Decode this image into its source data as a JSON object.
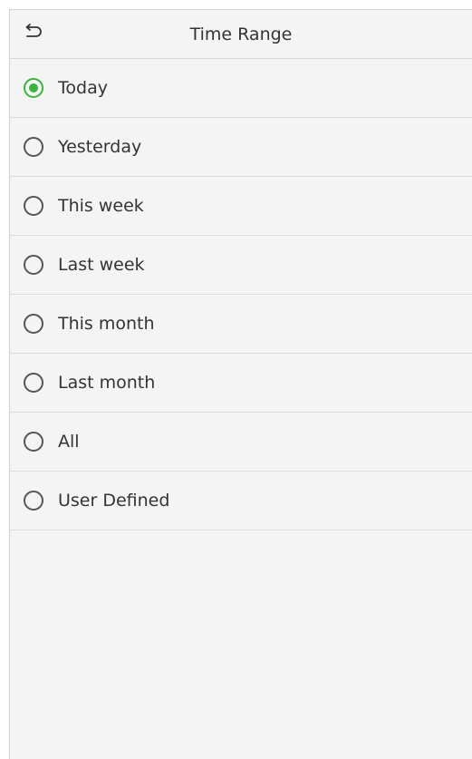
{
  "header": {
    "title": "Time Range",
    "back_icon": "back-arrow-icon"
  },
  "accent_color": "#3cb33c",
  "selected_index": 0,
  "options": [
    {
      "label": "Today"
    },
    {
      "label": "Yesterday"
    },
    {
      "label": "This week"
    },
    {
      "label": "Last week"
    },
    {
      "label": "This month"
    },
    {
      "label": "Last month"
    },
    {
      "label": "All"
    },
    {
      "label": "User Defined"
    }
  ]
}
